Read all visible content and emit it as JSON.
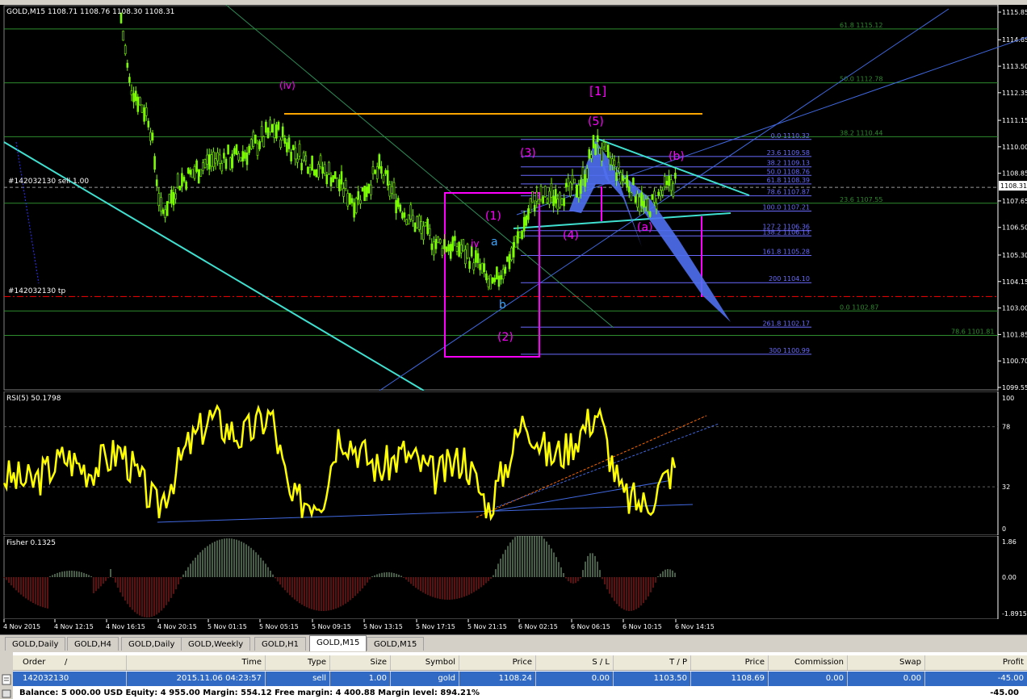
{
  "main_chart": {
    "header": "GOLD,M15  1108.71 1108.76 1108.30 1108.31",
    "price_axis": [
      "1115.85",
      "1114.65",
      "1113.50",
      "1112.35",
      "1111.15",
      "1110.00",
      "1108.85",
      "1107.65",
      "1106.50",
      "1105.30",
      "1104.15",
      "1103.00",
      "1101.85",
      "1100.70",
      "1099.55"
    ],
    "current_price": "1108.31",
    "order_label": "#142032130 sell 1.00",
    "tp_label": "#142032130 tp",
    "fib_green": [
      "61.8 1115.12",
      "50.0 1112.78",
      "38.2 1110.44",
      "23.6 1107.55",
      "0.0 1102.87",
      "78.6 1101.81"
    ],
    "fib_blue": [
      "0.0 1110.32",
      "23.6 1109.58",
      "38.2 1109.13",
      "50.0 1108.76",
      "61.8 1108.39",
      "78.6 1107.87",
      "100.0 1107.21",
      "127.2 1106.36",
      "138.2 1106.13",
      "161.8 1105.28",
      "200 1104.10",
      "261.8 1102.17",
      "300 1100.99"
    ],
    "waves": {
      "iv_big": "(iv)",
      "w1_box": "[1]",
      "w5": "(5)",
      "w3": "(3)",
      "wb": "(b)",
      "w1": "(1)",
      "iv_small": "iv",
      "a": "a",
      "b": "b",
      "w4": "(4)",
      "wa": "(a)",
      "w2": "(2)"
    }
  },
  "rsi": {
    "header": "RSI(5) 50.1798",
    "levels": [
      "100",
      "78",
      "32",
      "0"
    ]
  },
  "fisher": {
    "header": "Fisher 0.1325",
    "levels": [
      "1.86",
      "0.00",
      "-1.8915"
    ]
  },
  "time_axis": [
    "4 Nov 2015",
    "4 Nov 12:15",
    "4 Nov 16:15",
    "4 Nov 20:15",
    "5 Nov 01:15",
    "5 Nov 05:15",
    "5 Nov 09:15",
    "5 Nov 13:15",
    "5 Nov 17:15",
    "5 Nov 21:15",
    "6 Nov 02:15",
    "6 Nov 06:15",
    "6 Nov 10:15",
    "6 Nov 14:15"
  ],
  "tabs": [
    {
      "label": "GOLD,Daily",
      "active": false
    },
    {
      "label": "GOLD,H4",
      "active": false
    },
    {
      "label": "GOLD,Daily",
      "active": false
    },
    {
      "label": "GOLD,Weekly",
      "active": false
    },
    {
      "label": "GOLD,H1",
      "active": false
    },
    {
      "label": "GOLD,M15",
      "active": true
    },
    {
      "label": "GOLD,M15",
      "active": false
    }
  ],
  "terminal": {
    "columns": [
      "Order",
      "/",
      "Time",
      "Type",
      "Size",
      "Symbol",
      "Price",
      "S / L",
      "T / P",
      "Price",
      "Commission",
      "Swap",
      "Profit"
    ],
    "row": {
      "order": "142032130",
      "time": "2015.11.06 04:23:57",
      "type": "sell",
      "size": "1.00",
      "symbol": "gold",
      "price": "1108.24",
      "sl": "0.00",
      "tp": "1103.50",
      "cur_price": "1108.69",
      "commission": "0.00",
      "swap": "0.00",
      "profit": "-45.00"
    },
    "balance_line": "Balance: 5 000.00 USD  Equity: 4 955.00  Margin: 554.12  Free margin: 4 400.88  Margin level: 894.21%",
    "balance_profit": "-45.00"
  },
  "colors": {
    "candle": "#7cfc00",
    "rsi": "#ffff00",
    "fisher_pos": "#8fbc8f",
    "fisher_neg": "#b22222",
    "wave": "#ff00ff",
    "fib_blue": "#6a6aff",
    "fib_green": "#2e8b2e",
    "channel": "#4169e1",
    "cyan": "#40e0d0",
    "orange": "#ffa500",
    "tp": "#ff0000"
  }
}
